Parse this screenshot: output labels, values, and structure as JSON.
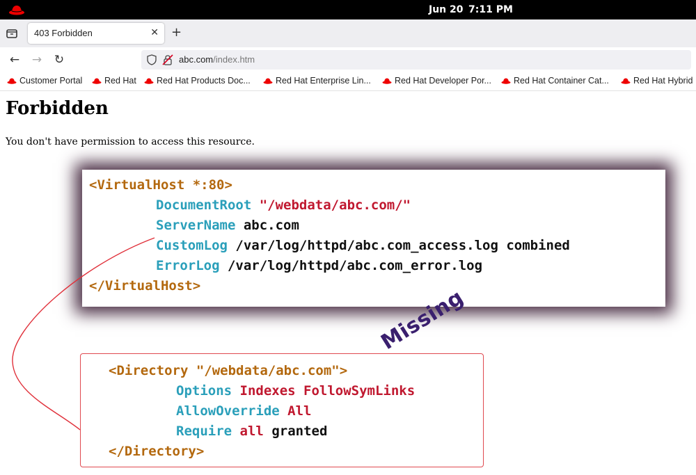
{
  "system_bar": {
    "date": "Jun 20",
    "time": "7:11 PM"
  },
  "browser": {
    "tab": {
      "title": "403 Forbidden",
      "close_icon": "close-icon"
    },
    "new_tab_icon": "plus-icon",
    "nav": {
      "back_icon": "arrow-left-icon",
      "forward_icon": "arrow-right-icon",
      "reload_icon": "reload-icon"
    },
    "url": {
      "host": "abc.com",
      "path": "/index.htm"
    },
    "bookmarks": [
      "Customer Portal",
      "Red Hat",
      "Red Hat Products Doc...",
      "Red Hat Enterprise Lin...",
      "Red Hat Developer Por...",
      "Red Hat Container Cat...",
      "Red Hat Hybrid"
    ]
  },
  "page": {
    "heading": "Forbidden",
    "message": "You don't have permission to access this resource."
  },
  "vhost_block": {
    "open_tag": "<VirtualHost *:80>",
    "lines": [
      {
        "directive": "DocumentRoot",
        "value": "\"/webdata/abc.com/\""
      },
      {
        "directive": "ServerName",
        "value": "abc.com"
      },
      {
        "directive": "CustomLog",
        "value": "/var/log/httpd/abc.com_access.log combined"
      },
      {
        "directive": "ErrorLog",
        "value": "/var/log/httpd/abc.com_error.log"
      }
    ],
    "close_tag": "</VirtualHost>"
  },
  "directory_block": {
    "open_tag_name": "<Directory ",
    "open_tag_path": "\"/webdata/abc.com\"",
    "open_tag_end": ">",
    "lines": [
      {
        "directive": "Options",
        "value": "Indexes FollowSymLinks"
      },
      {
        "directive": "AllowOverride",
        "value": "All"
      },
      {
        "directive": "Require",
        "value_red": "all",
        "value_plain": "granted"
      }
    ],
    "close_tag": "</Directory>"
  },
  "annotation": {
    "label": "Missing",
    "color": "#3a1f6e",
    "arrow_color": "#e0303a"
  },
  "colors": {
    "tag": "#b3680e",
    "directive": "#2a9fba",
    "string": "#c0182f"
  }
}
